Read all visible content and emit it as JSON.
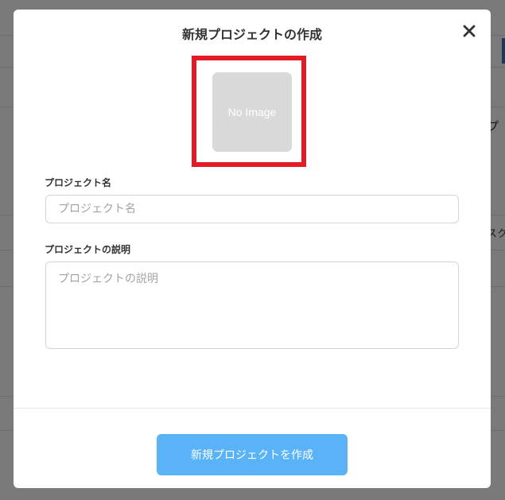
{
  "background": {
    "right_text_1": "プ",
    "right_text_2": "スク"
  },
  "modal": {
    "title": "新規プロジェクトの作成",
    "close_icon": "close-icon",
    "image_placeholder_text": "No Image",
    "highlight_color": "#e41b24",
    "project_name": {
      "label": "プロジェクト名",
      "placeholder": "プロジェクト名",
      "value": ""
    },
    "project_description": {
      "label": "プロジェクトの説明",
      "placeholder": "プロジェクトの説明",
      "value": ""
    },
    "submit_label": "新規プロジェクトを作成",
    "submit_color": "#5bb3f7"
  }
}
